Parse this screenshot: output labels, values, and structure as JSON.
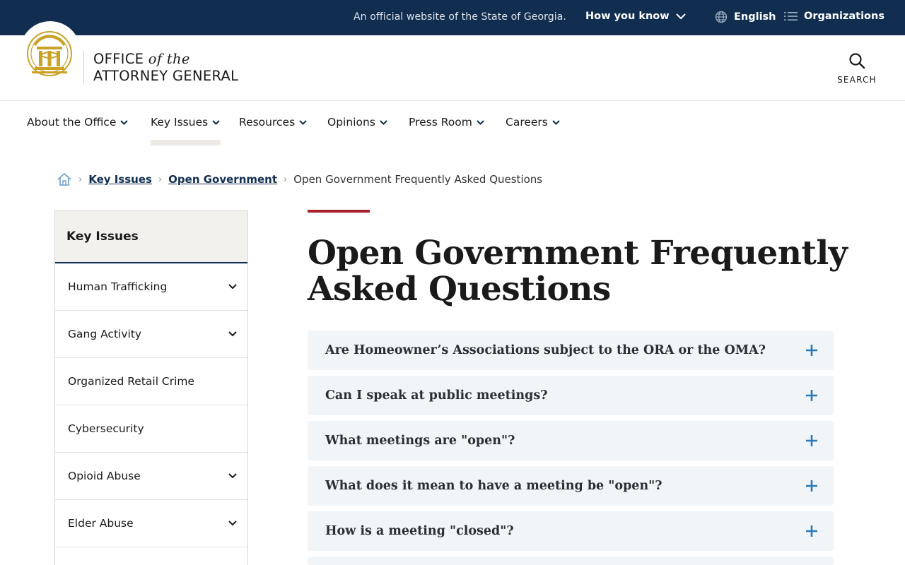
{
  "topbar": {
    "official_text": "An official website of the State of Georgia.",
    "how_you_know": "How you know",
    "language": "English",
    "organizations": "Organizations"
  },
  "header": {
    "brand_line1_a": "OFFICE",
    "brand_line1_b": "of the",
    "brand_line2": "ATTORNEY GENERAL",
    "search_label": "SEARCH"
  },
  "nav": {
    "items": [
      {
        "label": "About the Office"
      },
      {
        "label": "Key Issues"
      },
      {
        "label": "Resources"
      },
      {
        "label": "Opinions"
      },
      {
        "label": "Press Room"
      },
      {
        "label": "Careers"
      }
    ],
    "active": "Key Issues"
  },
  "breadcrumb": {
    "items": [
      "Key Issues",
      "Open Government"
    ],
    "current": "Open Government Frequently Asked Questions"
  },
  "sidebar": {
    "title": "Key Issues",
    "items": [
      {
        "label": "Human Trafficking",
        "expandable": true
      },
      {
        "label": "Gang Activity",
        "expandable": true
      },
      {
        "label": "Organized Retail Crime",
        "expandable": false
      },
      {
        "label": "Cybersecurity",
        "expandable": false
      },
      {
        "label": "Opioid Abuse",
        "expandable": true
      },
      {
        "label": "Elder Abuse",
        "expandable": true
      }
    ]
  },
  "page": {
    "title": "Open Government Frequently Asked Questions",
    "faqs": [
      "Are Homeowner’s Associations subject to the ORA or the OMA?",
      "Can I speak at public meetings?",
      "What meetings are \"open\"?",
      "What does it mean to have a meeting be \"open\"?",
      "How is a meeting \"closed\"?"
    ]
  },
  "colors": {
    "navy": "#112e51",
    "accent_red": "#a8202a",
    "accent_blue": "#2a7ab8",
    "gold": "#c9a227"
  }
}
